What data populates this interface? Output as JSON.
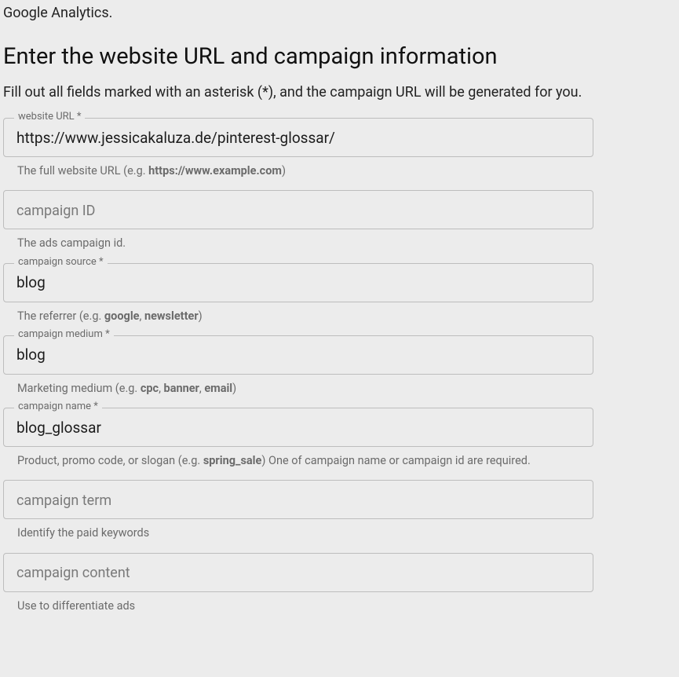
{
  "top_text": "Google Analytics.",
  "heading": "Enter the website URL and campaign information",
  "subheading": "Fill out all fields marked with an asterisk (*), and the campaign URL will be generated for you.",
  "fields": {
    "website_url": {
      "label": "website URL *",
      "value": "https://www.jessicakaluza.de/pinterest-glossar/",
      "helper_pre": "The full website URL (e.g. ",
      "helper_bold": "https://www.example.com",
      "helper_post": ")"
    },
    "campaign_id": {
      "placeholder": "campaign ID",
      "helper": "The ads campaign id."
    },
    "campaign_source": {
      "label": "campaign source *",
      "value": "blog",
      "helper_pre": "The referrer (e.g. ",
      "helper_b1": "google",
      "helper_mid": ", ",
      "helper_b2": "newsletter",
      "helper_post": ")"
    },
    "campaign_medium": {
      "label": "campaign medium *",
      "value": "blog",
      "helper_pre": "Marketing medium (e.g. ",
      "helper_b1": "cpc",
      "helper_s1": ", ",
      "helper_b2": "banner",
      "helper_s2": ", ",
      "helper_b3": "email",
      "helper_post": ")"
    },
    "campaign_name": {
      "label": "campaign name *",
      "value": "blog_glossar",
      "helper_pre": "Product, promo code, or slogan (e.g. ",
      "helper_b1": "spring_sale",
      "helper_post": ") One of campaign name or campaign id are required."
    },
    "campaign_term": {
      "placeholder": "campaign term",
      "helper": "Identify the paid keywords"
    },
    "campaign_content": {
      "placeholder": "campaign content",
      "helper": "Use to differentiate ads"
    }
  }
}
